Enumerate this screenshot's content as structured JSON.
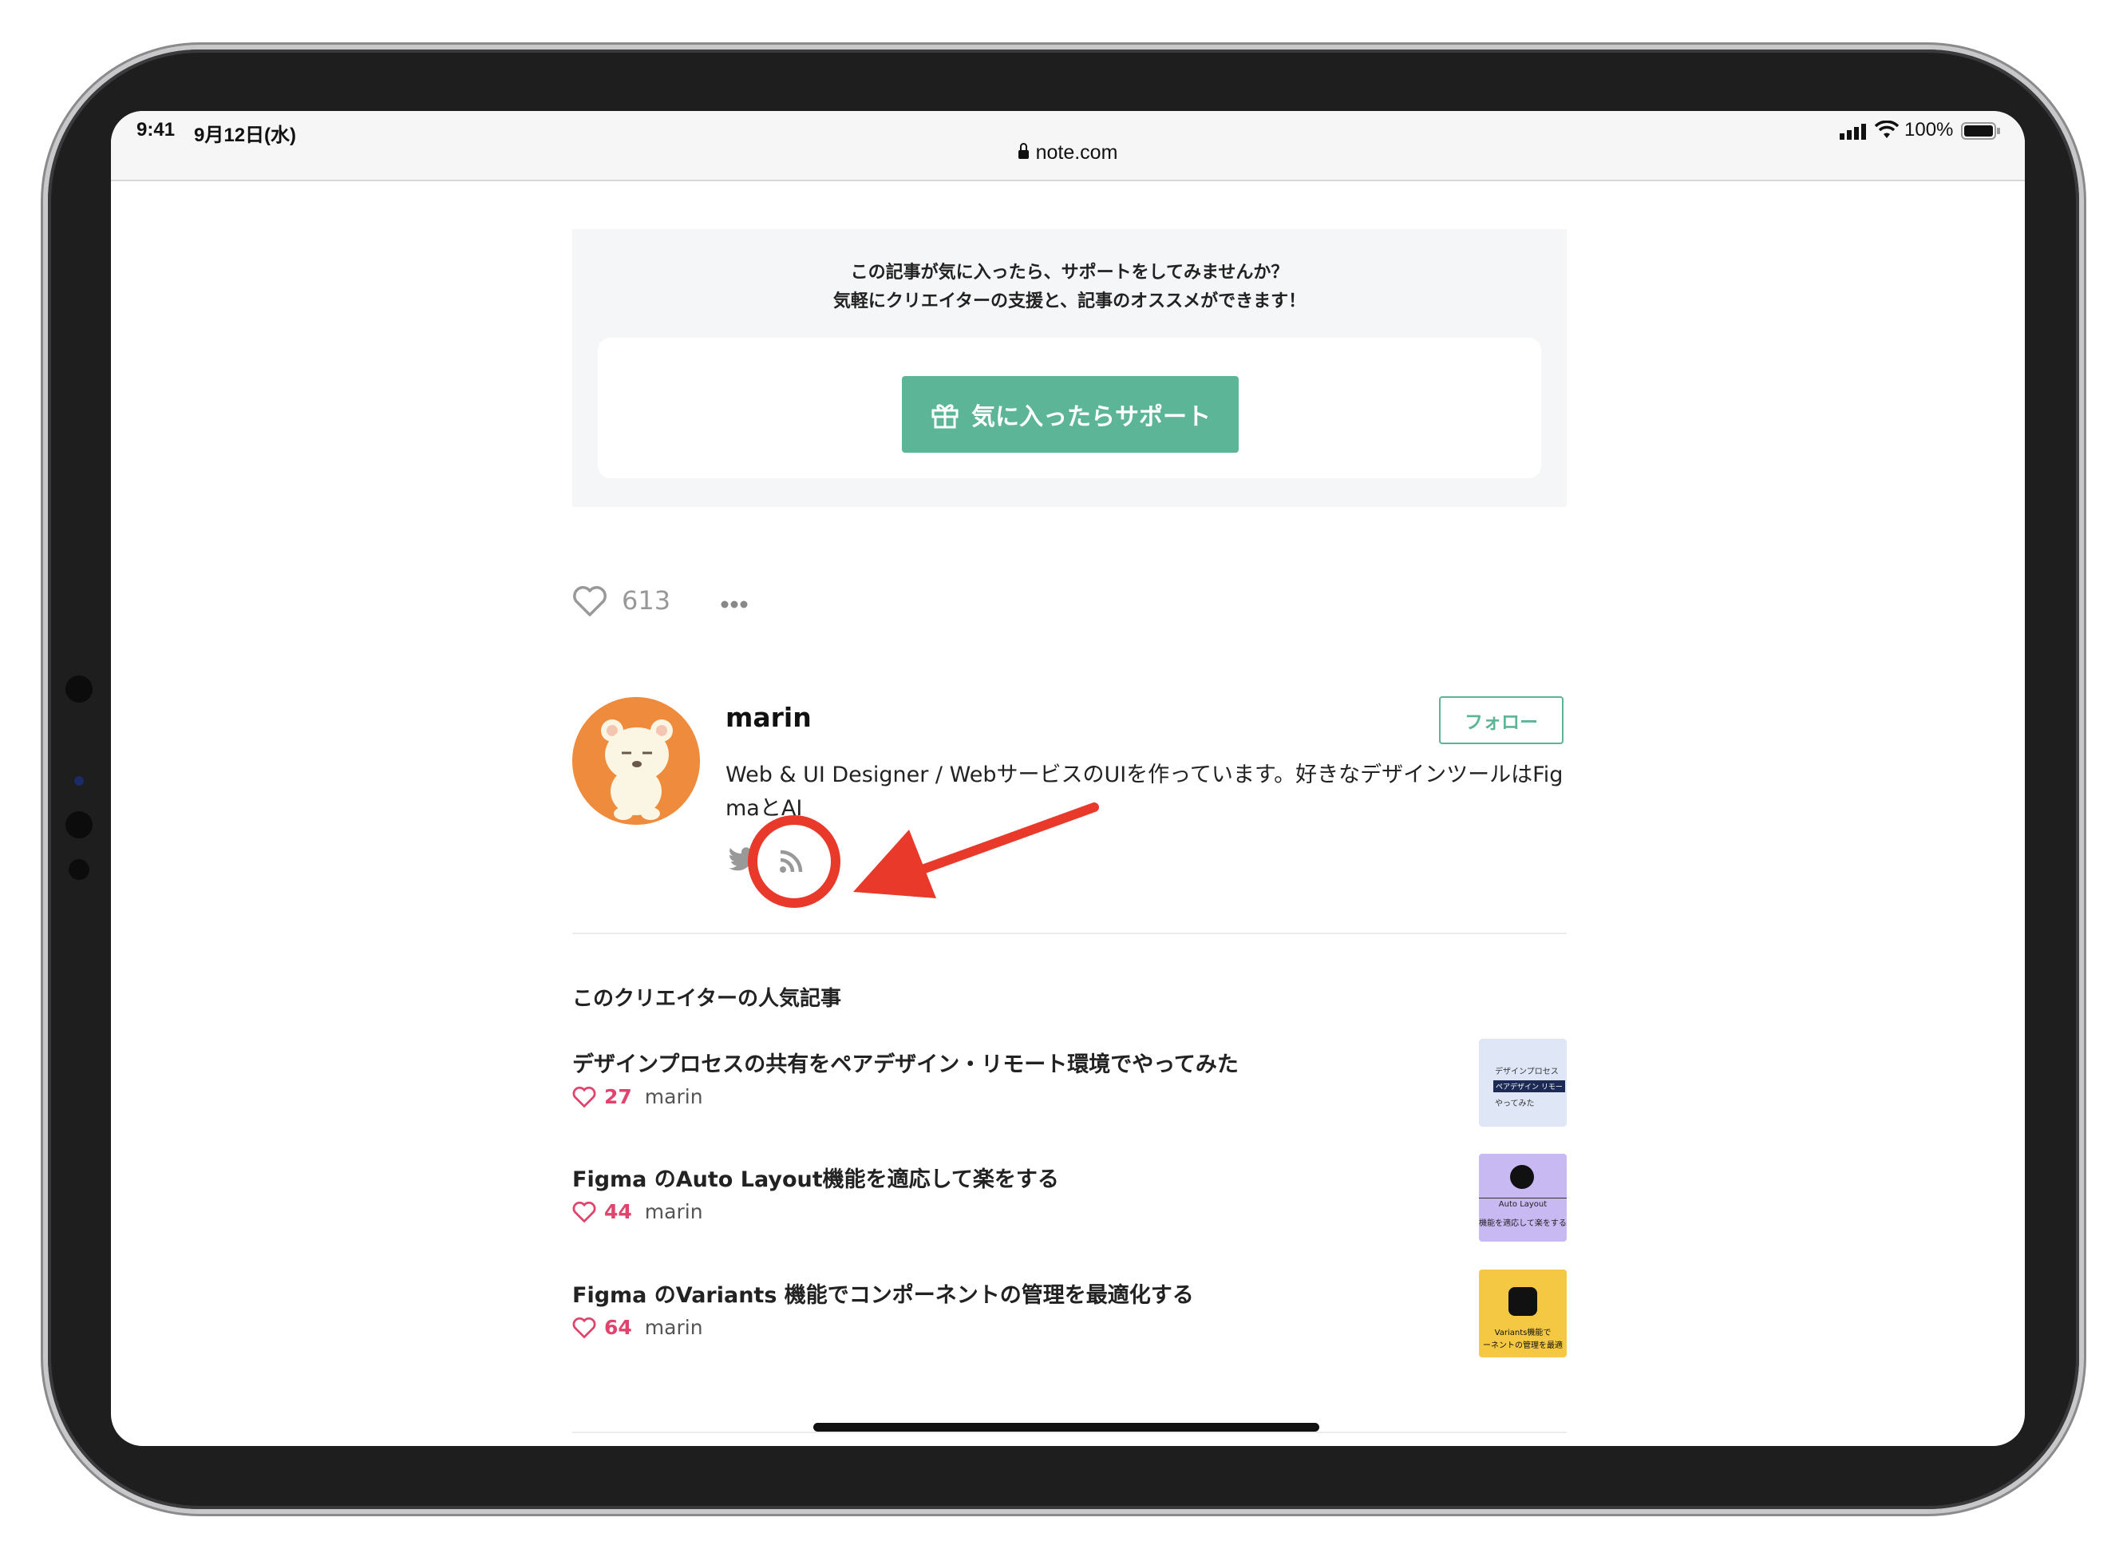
{
  "status_bar": {
    "time": "9:41",
    "date": "9月12日(水)",
    "battery": "100%"
  },
  "browser": {
    "url": "note.com"
  },
  "support": {
    "message_line1": "この記事が気に入ったら、サポートをしてみませんか？",
    "message_line2": "気軽にクリエイターの支援と、記事のオススメができます！",
    "button_label": "気に入ったらサポート"
  },
  "reactions": {
    "like_count": "613"
  },
  "author": {
    "name": "marin",
    "follow_label": "フォロー",
    "bio_line1": "Web & UI Designer / WebサービスのUIを作っています。好きなデザインツールはFig",
    "bio_line2": "maとAI",
    "links": [
      "twitter-icon",
      "rss-icon"
    ]
  },
  "popular": {
    "section_title": "このクリエイターの人気記事",
    "articles": [
      {
        "title": "デザインプロセスの共有をペアデザイン・リモート環境でやってみた",
        "likes": "27",
        "author": "marin",
        "thumb": {
          "lines": [
            "デザインプロセス",
            "ペアデザイン リモー",
            "やってみた"
          ],
          "bg": "#dfe7f7"
        }
      },
      {
        "title": "Figma のAuto Layout機能を適応して楽をする",
        "likes": "44",
        "author": "marin",
        "thumb": {
          "lines": [
            "Auto Layout",
            "機能を適応して楽をする"
          ],
          "bg": "#c9b9f2"
        }
      },
      {
        "title": "Figma のVariants 機能でコンポーネントの管理を最適化する",
        "likes": "64",
        "author": "marin",
        "thumb": {
          "lines": [
            "Variants機能で",
            "ーネントの管理を最適"
          ],
          "bg": "#f5c843"
        }
      }
    ]
  },
  "colors": {
    "accent": "#5cb597",
    "like": "#e0436b",
    "annotation": "#e8392b"
  }
}
